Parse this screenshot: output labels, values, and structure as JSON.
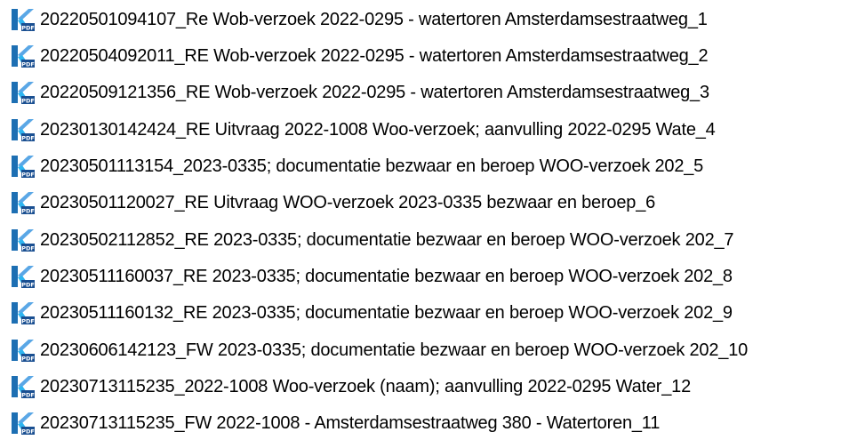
{
  "colors": {
    "icon_primary": "#1d6fb3",
    "icon_light": "#5aa7e6",
    "icon_accent": "#2eb5f0",
    "icon_badge": "#1a4f91",
    "text": "#000000",
    "background": "#ffffff"
  },
  "icon_semantic": "pdf-file-icon",
  "icon_badge_text": "PDF",
  "files": [
    {
      "name": "20220501094107_Re Wob-verzoek 2022-0295 - watertoren Amsterdamsestraatweg_1"
    },
    {
      "name": "20220504092011_RE Wob-verzoek 2022-0295 - watertoren Amsterdamsestraatweg_2"
    },
    {
      "name": "20220509121356_RE Wob-verzoek 2022-0295 - watertoren Amsterdamsestraatweg_3"
    },
    {
      "name": "20230130142424_RE Uitvraag 2022-1008 Woo-verzoek; aanvulling 2022-0295 Wate_4"
    },
    {
      "name": "20230501113154_2023-0335; documentatie bezwaar en beroep WOO-verzoek 202_5"
    },
    {
      "name": "20230501120027_RE Uitvraag WOO-verzoek 2023-0335  bezwaar en beroep_6"
    },
    {
      "name": "20230502112852_RE 2023-0335; documentatie bezwaar en beroep WOO-verzoek 202_7"
    },
    {
      "name": "20230511160037_RE 2023-0335; documentatie bezwaar en beroep WOO-verzoek 202_8"
    },
    {
      "name": "20230511160132_RE 2023-0335; documentatie bezwaar en beroep WOO-verzoek 202_9"
    },
    {
      "name": "20230606142123_FW 2023-0335; documentatie bezwaar en beroep WOO-verzoek 202_10"
    },
    {
      "name": "20230713115235_2022-1008 Woo-verzoek (naam); aanvulling 2022-0295 Water_12"
    },
    {
      "name": "20230713115235_FW 2022-1008 - Amsterdamsestraatweg 380 - Watertoren_11"
    }
  ]
}
